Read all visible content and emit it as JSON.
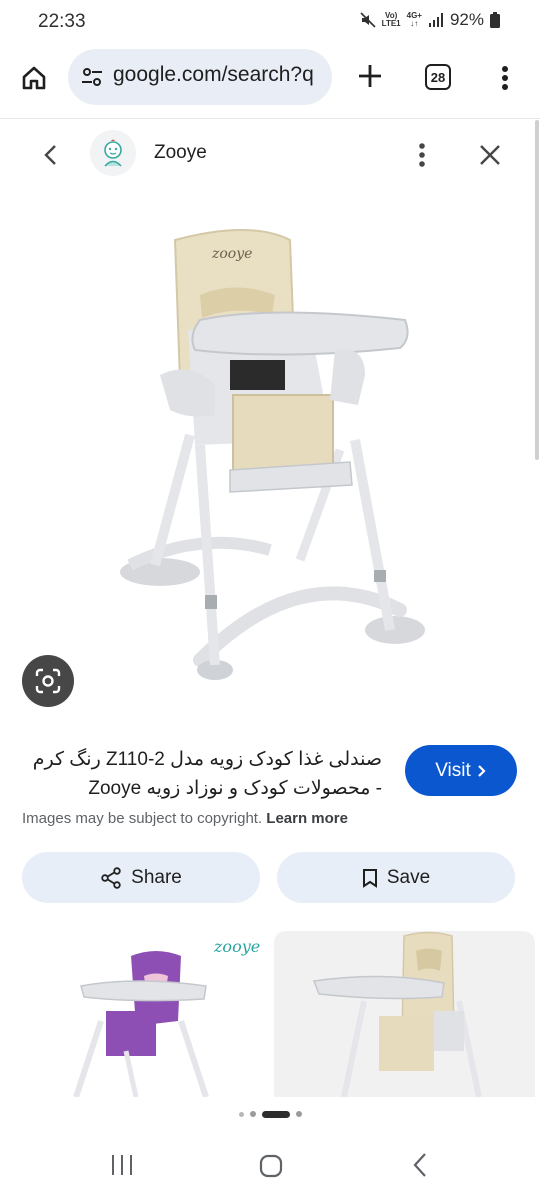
{
  "status_bar": {
    "time": "22:33",
    "network_top": "Vo)",
    "network_bottom": "LTE1",
    "network_type": "4G+",
    "battery": "92%"
  },
  "browser": {
    "url": "google.com/search?q",
    "tab_count": "28"
  },
  "viewer": {
    "site_name": "Zooye",
    "result_title": "صندلی غذا کودک زویه مدل Z110-2 رنگ کرم - محصولات کودک و نوزاد زویه Zooye",
    "visit_label": "Visit",
    "copyright_text": "Images may be subject to copyright.",
    "learn_more_label": "Learn more",
    "share_label": "Share",
    "save_label": "Save",
    "related_logo": "zooye"
  },
  "colors": {
    "accent": "#0b57d0",
    "chip_bg": "#e8eef8",
    "url_bg": "#e9eef6",
    "chair_cream": "#e8dcc0",
    "chair_purple": "#8e4fb5",
    "chair_frame": "#d8dbdf"
  },
  "icons": [
    "home-icon",
    "tune-icon",
    "plus-icon",
    "more-vert-icon",
    "back-arrow-icon",
    "close-icon",
    "lens-icon",
    "chevron-right-icon",
    "share-icon",
    "bookmark-icon"
  ]
}
